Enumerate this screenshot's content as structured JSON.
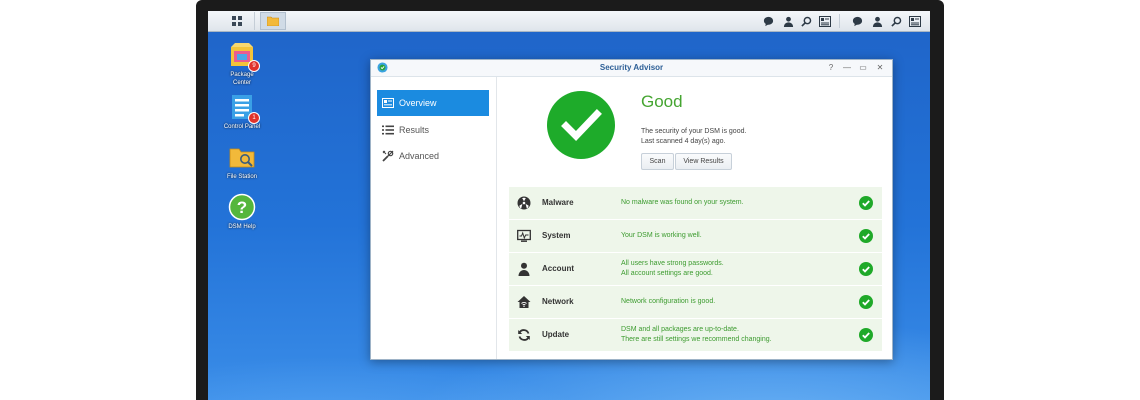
{
  "desktop": {
    "icons": [
      {
        "label_line1": "Package",
        "label_line2": "Center",
        "badge": "9"
      },
      {
        "label_line1": "Control Panel",
        "label_line2": "",
        "badge": "1"
      },
      {
        "label_line1": "File Station",
        "label_line2": "",
        "badge": ""
      },
      {
        "label_line1": "DSM Help",
        "label_line2": "",
        "badge": ""
      }
    ]
  },
  "window": {
    "title": "Security Advisor",
    "controls": {
      "help": "?",
      "minimize": "—",
      "maximize": "▭",
      "close": "✕"
    }
  },
  "sidebar": {
    "items": [
      {
        "label": "Overview",
        "icon": "overview-icon",
        "active": true
      },
      {
        "label": "Results",
        "icon": "list-icon",
        "active": false
      },
      {
        "label": "Advanced",
        "icon": "tools-icon",
        "active": false
      }
    ]
  },
  "overview": {
    "status": "Good",
    "line1": "The security of your DSM is good.",
    "line2": "Last scanned 4 day(s) ago.",
    "scan_label": "Scan",
    "view_results_label": "View Results"
  },
  "results": [
    {
      "name": "Malware",
      "icon": "radiation-icon",
      "desc1": "No malware was found on your system.",
      "desc2": ""
    },
    {
      "name": "System",
      "icon": "monitor-icon",
      "desc1": "Your DSM is working well.",
      "desc2": ""
    },
    {
      "name": "Account",
      "icon": "user-icon",
      "desc1": "All users have strong passwords.",
      "desc2": "All account settings are good."
    },
    {
      "name": "Network",
      "icon": "home-network-icon",
      "desc1": "Network configuration is good.",
      "desc2": ""
    },
    {
      "name": "Update",
      "icon": "refresh-icon",
      "desc1": "DSM and all packages are up-to-date.",
      "desc2": "There are still settings we recommend changing."
    }
  ],
  "colors": {
    "accent": "#1b8be0",
    "good": "#1eab2a",
    "good_text": "#45a531"
  }
}
